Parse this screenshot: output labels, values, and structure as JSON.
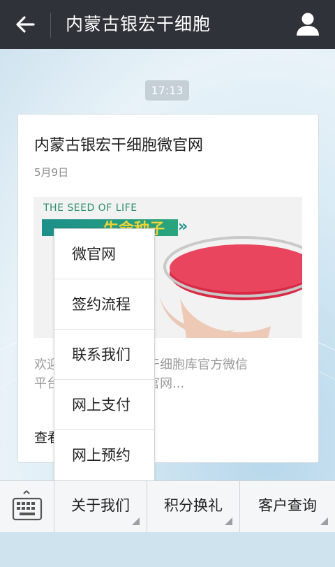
{
  "header": {
    "title": "内蒙古银宏干细胞",
    "back_icon": "back-arrow-icon",
    "user_icon": "user-profile-icon"
  },
  "chat": {
    "timestamp": "17:13"
  },
  "article": {
    "title": "内蒙古银宏干细胞微官网",
    "date": "5月9日",
    "cover_caption_en": "THE SEED  OF LIFE",
    "cover_caption_cn": "生命种子",
    "description_line1": "欢迎关注内蒙古银宏干细胞库官方微信",
    "description_line2": "平台，点击进入微信官网...",
    "read_more": "查看全文"
  },
  "popup_menu": {
    "items": [
      "微官网",
      "签约流程",
      "联系我们",
      "网上支付",
      "网上预约"
    ]
  },
  "bottom_menu": {
    "keyboard_icon": "keyboard-icon",
    "items": [
      "关于我们",
      "积分换礼",
      "客户查询"
    ]
  },
  "colors": {
    "topbar": "#2f3238",
    "accent_green": "#2aa57c"
  }
}
